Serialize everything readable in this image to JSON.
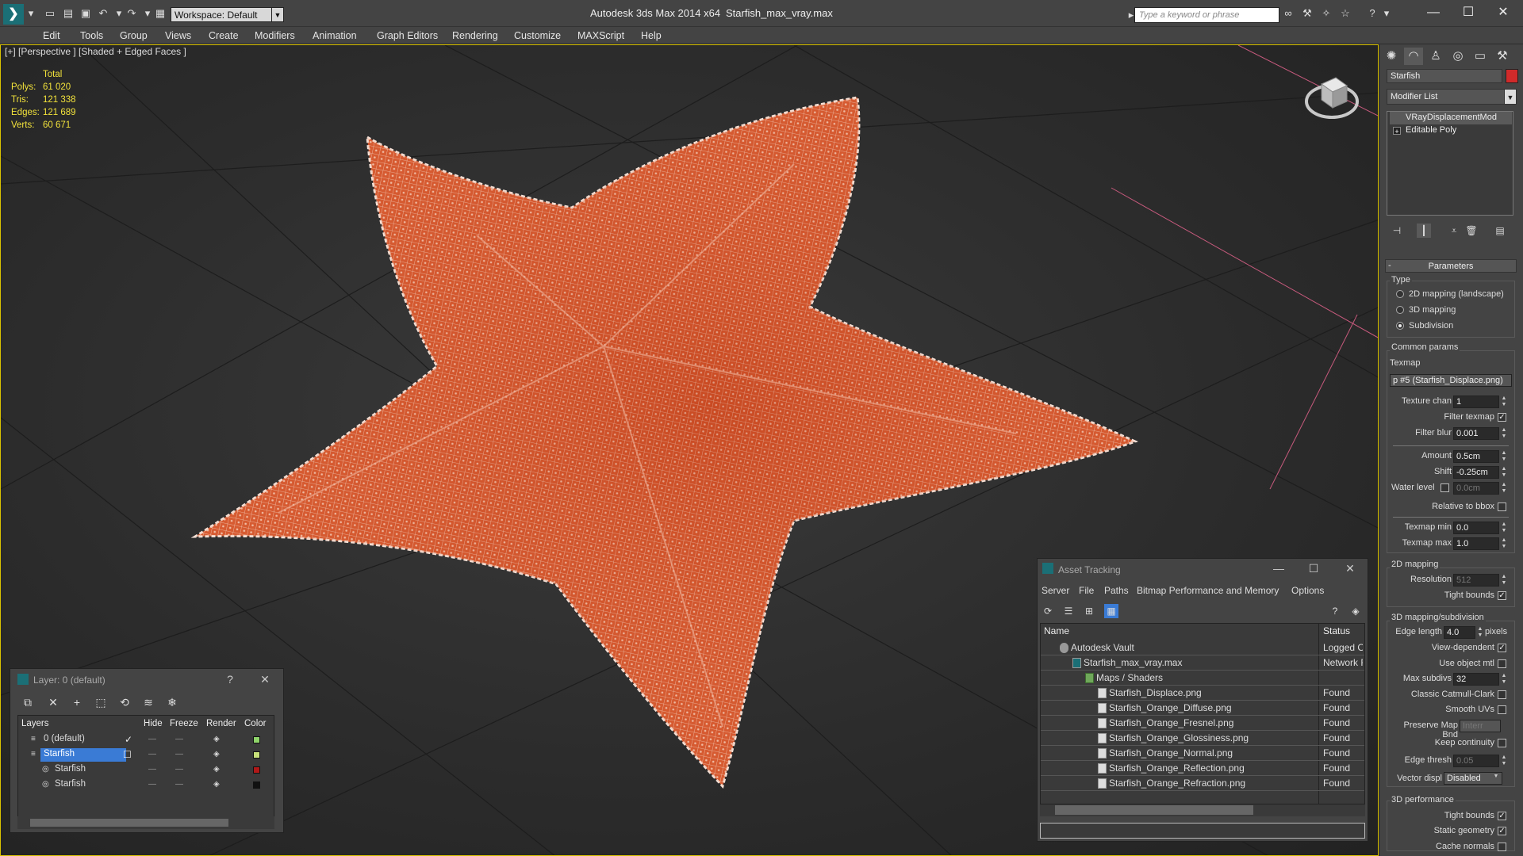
{
  "titlebar": {
    "workspace": "Workspace: Default",
    "title": "Autodesk 3ds Max  2014 x64",
    "file": "Starfish_max_vray.max",
    "search_placeholder": "Type a keyword or phrase"
  },
  "menu": [
    "Edit",
    "Tools",
    "Group",
    "Views",
    "Create",
    "Modifiers",
    "Animation",
    "Graph Editors",
    "Rendering",
    "Customize",
    "MAXScript",
    "Help"
  ],
  "viewport": {
    "label": "[+] [Perspective ] [Shaded + Edged Faces ]",
    "stats_header": "Total",
    "stats": [
      {
        "key": "Polys:",
        "value": "61 020"
      },
      {
        "key": "Tris:",
        "value": "121 338"
      },
      {
        "key": "Edges:",
        "value": "121 689"
      },
      {
        "key": "Verts:",
        "value": "60 671"
      }
    ]
  },
  "command_panel": {
    "object_name": "Starfish",
    "object_color": "#d12a2a",
    "modifier_list": "Modifier List",
    "stack": [
      "VRayDisplacementMod",
      "Editable Poly"
    ],
    "parameters": {
      "title": "Parameters",
      "type_label": "Type",
      "types": [
        "2D mapping (landscape)",
        "3D mapping",
        "Subdivision"
      ],
      "selected_type": "Subdivision",
      "common_params": "Common params",
      "texmap_label": "Texmap",
      "texmap_value": "p #5 (Starfish_Displace.png)",
      "texture_chan_label": "Texture chan",
      "texture_chan": "1",
      "filter_texmap_label": "Filter texmap",
      "filter_blur_label": "Filter blur",
      "filter_blur": "0.001",
      "amount_label": "Amount",
      "amount": "0.5cm",
      "shift_label": "Shift",
      "shift": "-0.25cm",
      "water_level_label": "Water level",
      "water_level": "0.0cm",
      "relative_bbox_label": "Relative to bbox",
      "texmap_min_label": "Texmap min",
      "texmap_min": "0.0",
      "texmap_max_label": "Texmap max",
      "texmap_max": "1.0",
      "mapping_2d": "2D mapping",
      "resolution_label": "Resolution",
      "resolution": "512",
      "tight_bounds_label": "Tight bounds",
      "mapping_3d": "3D mapping/subdivision",
      "edge_length_label": "Edge length",
      "edge_length": "4.0",
      "pixels_label": "pixels",
      "view_dependent_label": "View-dependent",
      "use_object_mtl_label": "Use object mtl",
      "max_subdivs_label": "Max subdivs",
      "max_subdivs": "32",
      "classic_catmull_label": "Classic Catmull-Clark",
      "smooth_uvs_label": "Smooth UVs",
      "preserve_map_label": "Preserve Map Bnd",
      "preserve_map_value": "Interr",
      "keep_continuity_label": "Keep continuity",
      "edge_thresh_label": "Edge thresh",
      "edge_thresh": "0.05",
      "vector_displ_label": "Vector displ",
      "vector_displ": "Disabled",
      "performance_3d": "3D performance",
      "tight_bounds2_label": "Tight bounds",
      "static_geometry_label": "Static geometry",
      "cache_normals_label": "Cache normals"
    }
  },
  "asset_tracking": {
    "title": "Asset Tracking",
    "menu": [
      "Server",
      "File",
      "Paths",
      "Bitmap Performance and Memory",
      "Options"
    ],
    "columns": [
      "Name",
      "Status"
    ],
    "rows": [
      {
        "name": "Autodesk Vault",
        "status": "Logged O",
        "indent": 0,
        "kind": "vault"
      },
      {
        "name": "Starfish_max_vray.max",
        "status": "Network F",
        "indent": 1,
        "kind": "max"
      },
      {
        "name": "Maps / Shaders",
        "status": "",
        "indent": 2,
        "kind": "folder"
      },
      {
        "name": "Starfish_Displace.png",
        "status": "Found",
        "indent": 3,
        "kind": "file"
      },
      {
        "name": "Starfish_Orange_Diffuse.png",
        "status": "Found",
        "indent": 3,
        "kind": "file"
      },
      {
        "name": "Starfish_Orange_Fresnel.png",
        "status": "Found",
        "indent": 3,
        "kind": "file"
      },
      {
        "name": "Starfish_Orange_Glossiness.png",
        "status": "Found",
        "indent": 3,
        "kind": "file"
      },
      {
        "name": "Starfish_Orange_Normal.png",
        "status": "Found",
        "indent": 3,
        "kind": "file"
      },
      {
        "name": "Starfish_Orange_Reflection.png",
        "status": "Found",
        "indent": 3,
        "kind": "file"
      },
      {
        "name": "Starfish_Orange_Refraction.png",
        "status": "Found",
        "indent": 3,
        "kind": "file"
      }
    ]
  },
  "layers": {
    "title": "Layer: 0 (default)",
    "columns": [
      "Layers",
      "Hide",
      "Freeze",
      "Render",
      "Color"
    ],
    "rows": [
      {
        "name": "0 (default)",
        "color": "#8fd46a",
        "selected": false,
        "indent": 0
      },
      {
        "name": "Starfish",
        "color": "#c7e07a",
        "selected": true,
        "indent": 0
      },
      {
        "name": "Starfish",
        "color": "#b01818",
        "selected": false,
        "indent": 1
      },
      {
        "name": "Starfish",
        "color": "#111111",
        "selected": false,
        "indent": 1
      }
    ]
  }
}
